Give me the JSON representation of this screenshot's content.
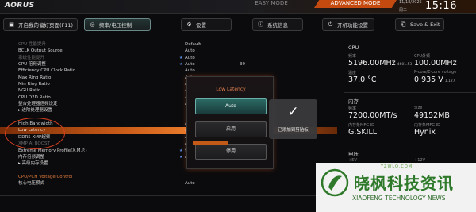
{
  "topbar": {
    "logo": "AORUS",
    "easy_mode": "EASY MODE",
    "advanced_mode": "ADVANCED MODE",
    "date": "11/18/2025",
    "weekday": "周二",
    "time": "15:16"
  },
  "tabs": [
    {
      "icon": "favorite-icon",
      "label": "开启我的偏好页面(F11)"
    },
    {
      "icon": "frequency-icon",
      "label": "频率/电压控制"
    },
    {
      "icon": "gear-icon",
      "label": "设置"
    },
    {
      "icon": "info-icon",
      "label": "系统信息"
    },
    {
      "icon": "power-icon",
      "label": "开机功能设置"
    },
    {
      "icon": "save-icon",
      "label": "Save & Exit"
    }
  ],
  "settings": {
    "rows": [
      {
        "label": "CPU 性能提升",
        "value": "Default",
        "dim": true
      },
      {
        "label": "BCLK Output Source",
        "value": "Auto"
      },
      {
        "label": "系统性能提升",
        "value": "Auto",
        "star": true,
        "dim": true
      },
      {
        "label": "CPU 倍频调整",
        "value": "Auto",
        "star": true,
        "num": "39"
      },
      {
        "label": "Efficiency CPU Clock Ratio",
        "value": "Auto"
      },
      {
        "label": "Max Ring Ratio",
        "value": "Auto"
      },
      {
        "label": "Min Ring Ratio",
        "value": "Auto"
      },
      {
        "label": "NGU Ratio",
        "value": "Auto"
      },
      {
        "label": "CPU D2D Ratio",
        "value": "Auto"
      },
      {
        "label": "整合处理器倍频设定",
        "value": "Auto"
      },
      {
        "label": "▸ 进阶处理器设置",
        "value": ""
      },
      {
        "label": "",
        "value": ""
      },
      {
        "label": "High Bandwidth",
        "value": "A"
      },
      {
        "label": "Low Latency",
        "value": "A",
        "highlight": true
      },
      {
        "label": "DDR5 XMP超频",
        "value": "Au"
      },
      {
        "label": "XMP AI BOOST",
        "value": "Au",
        "dim": true
      },
      {
        "label": "Extreme Memory Profile(X.M.P.)",
        "value": "停用",
        "star": true
      },
      {
        "label": "内存倍频调整",
        "value": "Auto",
        "star": true,
        "num": "5600"
      },
      {
        "label": "▸ 高级内存设置",
        "value": ""
      },
      {
        "label": "",
        "value": ""
      },
      {
        "label": "CPU/PCH Voltage Control",
        "value": "",
        "header": true
      },
      {
        "label": "核心电压模式",
        "value": "Auto"
      }
    ]
  },
  "info": {
    "cpu": {
      "title": "CPU",
      "freq_label": "频率",
      "freq": "5196.00MHz",
      "freq_sub": "4601.53",
      "bclk_label": "CPU外频",
      "bclk": "100.00MHz",
      "temp_label": "温度",
      "temp": "37.0 °C",
      "volt_label": "P-core/E-core voltage",
      "volt": "0.935 V",
      "volt_sub": "1.127"
    },
    "memory": {
      "title": "内存",
      "freq_label": "频率",
      "freq": "7200.00MT/s",
      "size_label": "Size",
      "size": "49152MB",
      "mfg1_label": "内存条MFG ID",
      "mfg1": "G.SKILL",
      "mfg2_label": "内存条MFG ID",
      "mfg2": "Hynix"
    },
    "voltage": {
      "title": "电压",
      "v5_label": "+5V",
      "v5": "",
      "v12_label": "+12V",
      "v12": ""
    }
  },
  "popup": {
    "title": "Low Latency",
    "options": [
      "Auto",
      "启用",
      "停用"
    ],
    "selected": "Auto"
  },
  "toast": {
    "message": "已添加到剪贴板"
  },
  "watermark": {
    "url": "YZWLO.COM",
    "chinese": "晓枫科技资讯",
    "english": "XIAOFENG TECHNOLOGY NEWS"
  },
  "colors": {
    "accent_orange": "#c45a18",
    "active_tab": "#6ab0a8",
    "watermark_green": "#2e7a2a"
  }
}
